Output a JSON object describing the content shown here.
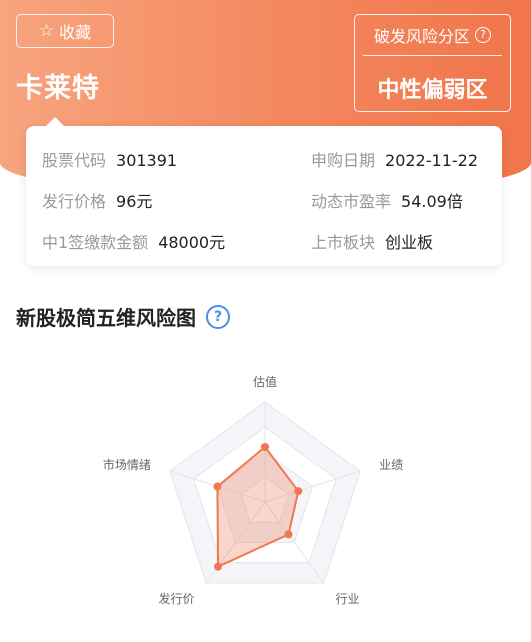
{
  "header": {
    "favorite_label": "收藏",
    "stock_name": "卡莱特",
    "risk_title": "破发风险分区",
    "risk_value": "中性偏弱区"
  },
  "info": {
    "code_label": "股票代码",
    "code_value": "301391",
    "date_label": "申购日期",
    "date_value": "2022-11-22",
    "price_label": "发行价格",
    "price_value": "96元",
    "pe_label": "动态市盈率",
    "pe_value": "54.09倍",
    "amount_label": "中1签缴款金额",
    "amount_value": "48000元",
    "board_label": "上市板块",
    "board_value": "创业板"
  },
  "section": {
    "title": "新股极简五维风险图"
  },
  "chart_data": {
    "type": "radar",
    "axes": [
      "估值",
      "业绩",
      "行业",
      "发行价",
      "市场情绪"
    ],
    "values": [
      0.55,
      0.35,
      0.4,
      0.8,
      0.5
    ],
    "max": 1,
    "levels": 4,
    "color": "#f0784f"
  },
  "colors": {
    "accent": "#f0784f",
    "help_blue": "#4a8fe8"
  },
  "icons": {
    "favorite": "star-outline-icon",
    "help": "question-circle-icon"
  }
}
